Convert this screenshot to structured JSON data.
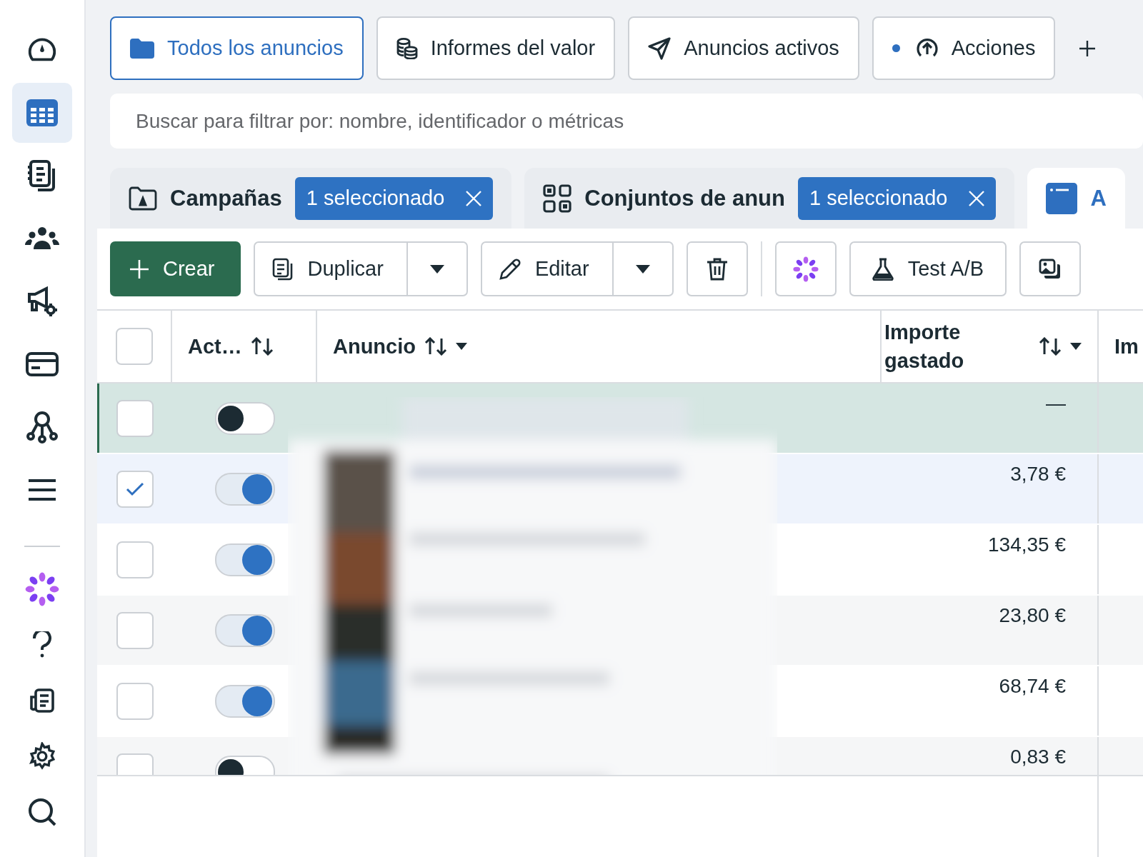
{
  "sidebar": {
    "items": [
      {
        "kind": "gauge",
        "selected": false
      },
      {
        "kind": "table",
        "selected": true
      },
      {
        "kind": "documents",
        "selected": false
      },
      {
        "kind": "people",
        "selected": false
      },
      {
        "kind": "megaphone",
        "selected": false
      },
      {
        "kind": "card",
        "selected": false
      },
      {
        "kind": "network",
        "selected": false
      },
      {
        "kind": "menu",
        "selected": false
      }
    ],
    "bottom_items": [
      {
        "kind": "flower",
        "selected": false
      },
      {
        "kind": "help",
        "selected": false
      },
      {
        "kind": "news",
        "selected": false
      },
      {
        "kind": "settings",
        "selected": false
      },
      {
        "kind": "search",
        "selected": false
      }
    ]
  },
  "tabs": [
    {
      "kind": "folder",
      "label": "Todos los anuncios",
      "selected": true,
      "dot": false
    },
    {
      "kind": "coins",
      "label": "Informes del valor",
      "selected": false,
      "dot": false
    },
    {
      "kind": "send",
      "label": "Anuncios activos",
      "selected": false,
      "dot": false
    },
    {
      "kind": "upload",
      "label": "Acciones",
      "selected": false,
      "dot": true
    }
  ],
  "search": {
    "placeholder": "Buscar para filtrar por: nombre, identificador o métricas"
  },
  "levels": [
    {
      "kind": "campaigns",
      "label": "Campañas",
      "selected": false,
      "badge": "1 seleccionado"
    },
    {
      "kind": "ad_sets",
      "label": "Conjuntos de anun",
      "selected": false,
      "badge": "1 seleccionado"
    },
    {
      "kind": "ads",
      "label": "A",
      "selected": true
    }
  ],
  "toolbar": [
    {
      "kind": "create",
      "label": "Crear"
    },
    {
      "kind": "duplicate",
      "label": "Duplicar"
    },
    {
      "kind": "edit",
      "label": "Editar"
    },
    {
      "kind": "delete"
    },
    {
      "kind": "ai"
    },
    {
      "kind": "ab_test",
      "label": "Test A/B"
    },
    {
      "kind": "media"
    }
  ],
  "table": {
    "all_selected": false,
    "columns": [
      {
        "label": "Act…",
        "sortable": true,
        "dropdown": false
      },
      {
        "label": "Anuncio",
        "sortable": true,
        "dropdown": true
      },
      {
        "label": "Importe gastado",
        "sortable": true,
        "dropdown": true
      },
      {
        "label": "Im",
        "sortable": false,
        "dropdown": false
      }
    ],
    "rows": [
      {
        "selected": false,
        "highlighted": true,
        "active": false,
        "spent": "—"
      },
      {
        "selected": true,
        "highlighted": false,
        "active": true,
        "spent": "3,78 €"
      },
      {
        "selected": false,
        "highlighted": false,
        "active": true,
        "spent": "134,35 €"
      },
      {
        "selected": false,
        "highlighted": false,
        "active": true,
        "spent": "23,80 €"
      },
      {
        "selected": false,
        "highlighted": false,
        "active": true,
        "spent": "68,74 €"
      },
      {
        "selected": false,
        "highlighted": false,
        "active": false,
        "spent": "0,83 €"
      }
    ]
  }
}
